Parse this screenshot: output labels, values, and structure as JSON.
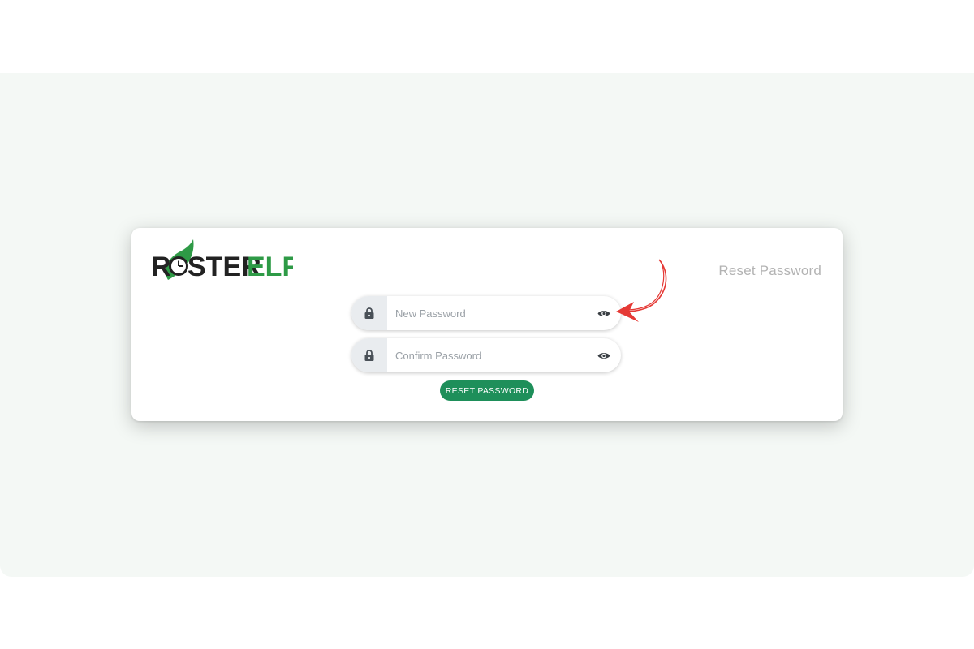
{
  "brand": {
    "name_prefix": "R",
    "name_middle": "STER",
    "name_suffix": "ELF",
    "dark_color": "#222222",
    "green_color": "#2e9a46"
  },
  "header": {
    "title": "Reset Password"
  },
  "form": {
    "new_password": {
      "placeholder": "New Password",
      "value": "",
      "icon": "lock-icon",
      "toggle_icon": "eye-icon"
    },
    "confirm_password": {
      "placeholder": "Confirm Password",
      "value": "",
      "icon": "lock-icon",
      "toggle_icon": "eye-icon"
    },
    "submit_label": "RESET PASSWORD"
  },
  "colors": {
    "accent": "#1e8f5a",
    "page_background": "#f4f8f5",
    "annotation_arrow": "#e53935"
  }
}
